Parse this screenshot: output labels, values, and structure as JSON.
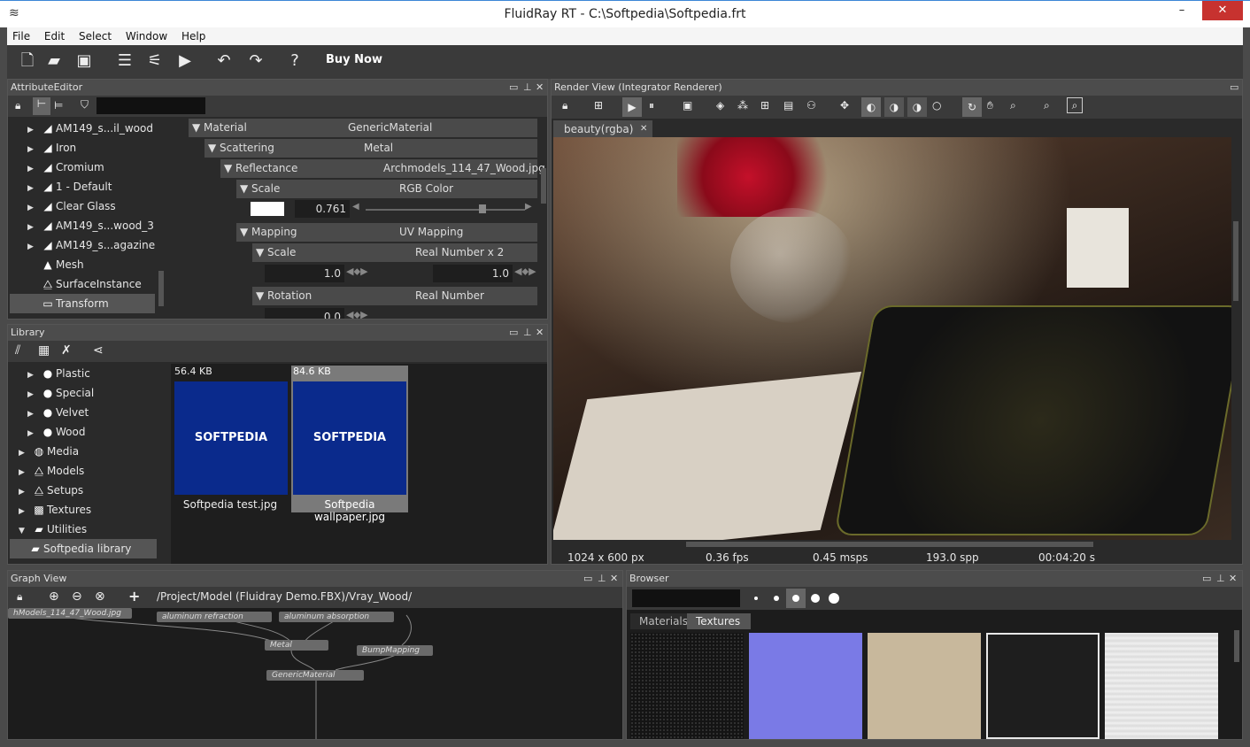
{
  "window": {
    "title": "FluidRay RT - C:\\Softpedia\\Softpedia.frt",
    "minimize": "–",
    "maximize": "□",
    "close": "✕"
  },
  "menu": [
    "File",
    "Edit",
    "Select",
    "Window",
    "Help"
  ],
  "toolbar": {
    "buy_now": "Buy Now"
  },
  "attribute_editor": {
    "title": "AttributeEditor",
    "tree": [
      {
        "label": "AM149_s...il_wood",
        "selected": false
      },
      {
        "label": "Iron",
        "selected": false
      },
      {
        "label": "Cromium",
        "selected": false
      },
      {
        "label": "1 - Default",
        "selected": false
      },
      {
        "label": "Clear Glass",
        "selected": false
      },
      {
        "label": "AM149_s...wood_3",
        "selected": false
      },
      {
        "label": "AM149_s...agazine",
        "selected": false
      },
      {
        "label": "Mesh",
        "selected": false
      },
      {
        "label": "SurfaceInstance",
        "selected": false
      },
      {
        "label": "Transform",
        "selected": true
      }
    ],
    "attrs": {
      "material_label": "Material",
      "material_value": "GenericMaterial",
      "scattering_label": "Scattering",
      "scattering_value": "Metal",
      "reflectance_label": "Reflectance",
      "reflectance_value": "Archmodels_114_47_Wood.jpg",
      "scale_label": "Scale",
      "scale_value": "RGB Color",
      "scale_number": "0.761",
      "mapping_label": "Mapping",
      "mapping_value": "UV Mapping",
      "mscale_label": "Scale",
      "mscale_value": "Real Number x 2",
      "mscale_a": "1.0",
      "mscale_b": "1.0",
      "rotation_label": "Rotation",
      "rotation_value": "Real Number",
      "rotation_number": "0.0"
    }
  },
  "library": {
    "title": "Library",
    "tree": [
      {
        "label": "Plastic",
        "indent": 1
      },
      {
        "label": "Special",
        "indent": 1
      },
      {
        "label": "Velvet",
        "indent": 1
      },
      {
        "label": "Wood",
        "indent": 1
      },
      {
        "label": "Media",
        "indent": 0
      },
      {
        "label": "Models",
        "indent": 0
      },
      {
        "label": "Setups",
        "indent": 0
      },
      {
        "label": "Textures",
        "indent": 0
      },
      {
        "label": "Utilities",
        "indent": 0
      },
      {
        "label": "Softpedia library",
        "indent": 1
      }
    ],
    "items": [
      {
        "size": "56.4 KB",
        "name": "Softpedia test.jpg",
        "logo": "SOFTPEDIA"
      },
      {
        "size": "84.6 KB",
        "name": "Softpedia wallpaper.jpg",
        "logo": "SOFTPEDIA"
      }
    ]
  },
  "render_view": {
    "title": "Render View (Integrator Renderer)",
    "tab": "beauty(rgba)",
    "tab_close": "✕",
    "status": {
      "resolution": "1024 x 600 px",
      "fps": "0.36 fps",
      "msps": "0.45 msps",
      "spp": "193.0 spp",
      "time": "00:04:20 s"
    }
  },
  "graph_view": {
    "title": "Graph View",
    "path": "/Project/Model (Fluidray Demo.FBX)/Vray_Wood/",
    "nodes": [
      "hModels_114_47_Wood.jpg",
      "aluminum refraction",
      "aluminum absorption",
      "Metal",
      "BumpMapping",
      "GenericMaterial"
    ]
  },
  "browser": {
    "title": "Browser",
    "tabs": [
      "Materials",
      "Textures"
    ]
  },
  "colors": {
    "accent": "#3c86d6",
    "close": "#c7322f",
    "thumb_blue": "#0a2a8c"
  }
}
